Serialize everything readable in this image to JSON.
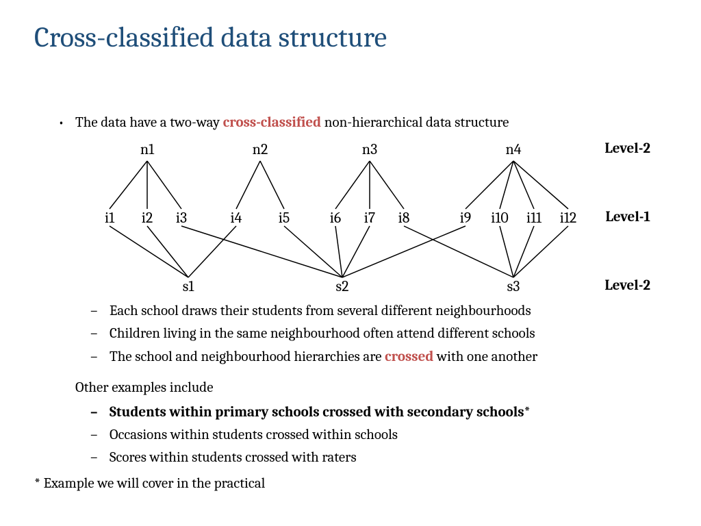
{
  "title": "Cross-classified data structure",
  "bullet1_pre": "The data have a two-way ",
  "bullet1_accent": "cross-classified",
  "bullet1_post": " non-hierarchical data structure",
  "diagram": {
    "n": [
      "n1",
      "n2",
      "n3",
      "n4"
    ],
    "i": [
      "i1",
      "i2",
      "i3",
      "i4",
      "i5",
      "i6",
      "i7",
      "i8",
      "i9",
      "i10",
      "i11",
      "i12"
    ],
    "s": [
      "s1",
      "s2",
      "s3"
    ],
    "level2_top": "Level-2",
    "level1": "Level-1",
    "level2_bot": "Level-2"
  },
  "sub1a": "Each school draws their students from several different neighbourhoods",
  "sub1b": "Children living in the same neighbourhood often attend different schools",
  "sub1c_pre": "The school and neighbourhood hierarchies are ",
  "sub1c_accent": "crossed",
  "sub1c_post": " with one another",
  "bullet2": "Other examples include",
  "sub2a": "Students within primary schools crossed with secondary schools*",
  "sub2b": "Occasions within students crossed within schools",
  "sub2c": "Scores within students crossed with raters",
  "footnote": "* Example we will cover in the practical"
}
